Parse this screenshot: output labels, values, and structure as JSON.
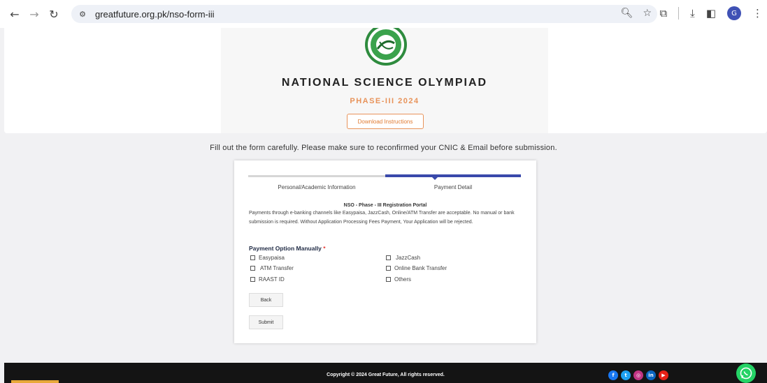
{
  "browser": {
    "url": "greatfuture.org.pk/nso-form-iii",
    "avatar_letter": "G"
  },
  "header": {
    "title": "NATIONAL SCIENCE OLYMPIAD",
    "phase": "PHASE-III 2024",
    "download_label": "Download Instructions"
  },
  "instruction": "Fill out the form carefully. Please make sure to reconfirmed your CNIC & Email before submission.",
  "form": {
    "steps": [
      {
        "label": "Personal/Academic Information",
        "active": false
      },
      {
        "label": "Payment Detail",
        "active": true
      }
    ],
    "portal_title": "NSO - Phase - III Registration Portal",
    "portal_desc": "Payments through e-banking channels like Easypaisa, JazzCash, Online/ATM Transfer are acceptable. No manual or bank submission is required. Without Application Processing Fees Payment, Your Application will be rejected.",
    "payment_label": "Payment Option Manually",
    "required_mark": "*",
    "options": [
      {
        "label": "Easypaisa",
        "checked": false
      },
      {
        "label": "JazzCash",
        "checked": false
      },
      {
        "label": "ATM Transfer",
        "checked": false
      },
      {
        "label": "Online Bank Transfer",
        "checked": false
      },
      {
        "label": "RAAST ID",
        "checked": false
      },
      {
        "label": "Others",
        "checked": false
      }
    ],
    "back_label": "Back",
    "submit_label": "Submit"
  },
  "footer": {
    "copyright": "Copyright © 2024 Great Future, All rights reserved.",
    "socials": [
      "facebook-icon",
      "twitter-icon",
      "instagram-icon",
      "linkedin-icon",
      "youtube-icon"
    ]
  },
  "colors": {
    "accent_orange": "#e8935a",
    "step_active": "#3949ab",
    "footer_bg": "#141414",
    "whatsapp": "#25d366"
  }
}
